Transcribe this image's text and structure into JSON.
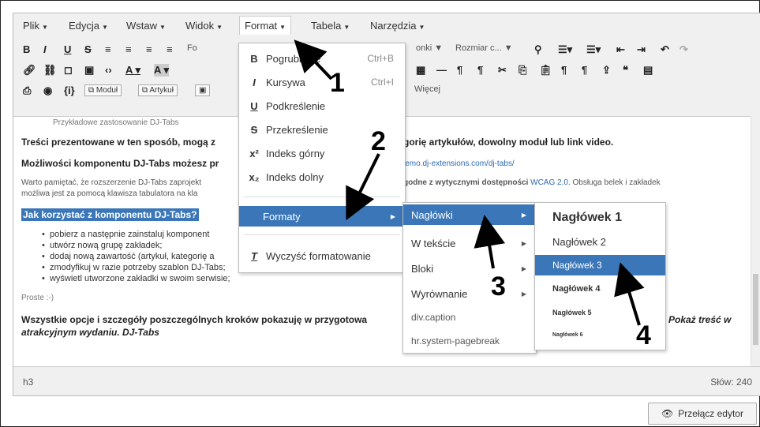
{
  "menubar": {
    "items": [
      {
        "label": "Plik"
      },
      {
        "label": "Edycja"
      },
      {
        "label": "Wstaw"
      },
      {
        "label": "Widok"
      },
      {
        "label": "Format"
      },
      {
        "label": "Tabela"
      },
      {
        "label": "Narzędzia"
      }
    ]
  },
  "toolbar": {
    "row1_fo": "Fo",
    "row1_bloki": "onki",
    "row1_rozmiar": "Rozmiar c...",
    "row3_modul": "Moduł",
    "row3_artykul": "Artykuł",
    "row3_wiecej": "Więcej"
  },
  "format_menu": {
    "items": [
      {
        "icon": "B",
        "label": "Pogrubienie",
        "shortcut": "Ctrl+B"
      },
      {
        "icon": "I",
        "label": "Kursywa",
        "shortcut": "Ctrl+I"
      },
      {
        "icon": "U",
        "label": "Podkreślenie",
        "shortcut": ""
      },
      {
        "icon": "S",
        "label": "Przekreślenie",
        "shortcut": ""
      },
      {
        "icon": "x²",
        "label": "Indeks górny",
        "shortcut": ""
      },
      {
        "icon": "x₂",
        "label": "Indeks dolny",
        "shortcut": ""
      }
    ],
    "formaty": "Formaty",
    "clear": "Wyczyść formatowanie"
  },
  "formaty_menu": {
    "items": [
      "Nagłówki",
      "W tekście",
      "Bloki",
      "Wyrównanie",
      "div.caption",
      "hr.system-pagebreak"
    ]
  },
  "naglowki_menu": {
    "items": [
      "Nagłówek 1",
      "Nagłówek 2",
      "Nagłówek 3",
      "Nagłówek 4",
      "Nagłówek 5",
      "Nagłówek 6"
    ]
  },
  "content": {
    "caption": "Przykładowe zastosowanie DJ-Tabs",
    "line1_a": "Treści prezentowane w ten sposób, mogą z",
    "line1_b": "gorię artykułów, dowolny moduł lub link video.",
    "line2_a": "Możliwości komponentu DJ-Tabs możesz pr",
    "line2_link": "lemo.dj-extensions.com/dj-tabs/",
    "line3_a": "Warto pamiętać, że rozszerzenie DJ-Tabs zaprojekt",
    "line3_b": "godne z wytycznymi dostępności",
    "line3_link": "WCAG 2.0",
    "line3_c": ". Obsługa belek i zakładek",
    "line4": "możliwa jest za pomocą klawisza tabulatora na kla",
    "heading": "Jak korzystać z komponentu DJ-Tabs?",
    "bullets": [
      "pobierz a następnie zainstaluj komponent",
      "utwórz nową grupę zakładek;",
      "dodaj nową zawartość (artykuł, kategorię a",
      "zmodyfikuj w razie potrzeby szablon DJ-Tabs;",
      "wyświetl utworzone zakładki w swoim serwisie;"
    ],
    "proste": "Proste :-)",
    "final_a": "Wszystkie opcje i szczegóły poszczególnych kroków pokazuję w przygotowa",
    "final_b": "Pokaż treść w",
    "final_c": "atrakcyjnym wydaniu. DJ-Tabs"
  },
  "statusbar": {
    "path": "h3",
    "words": "Słów: 240"
  },
  "toggle_button": "Przełącz edytor",
  "annotations": [
    "1",
    "2",
    "3",
    "4"
  ],
  "colors": {
    "selected": "#3a76b8",
    "link": "#2a6ab1"
  }
}
